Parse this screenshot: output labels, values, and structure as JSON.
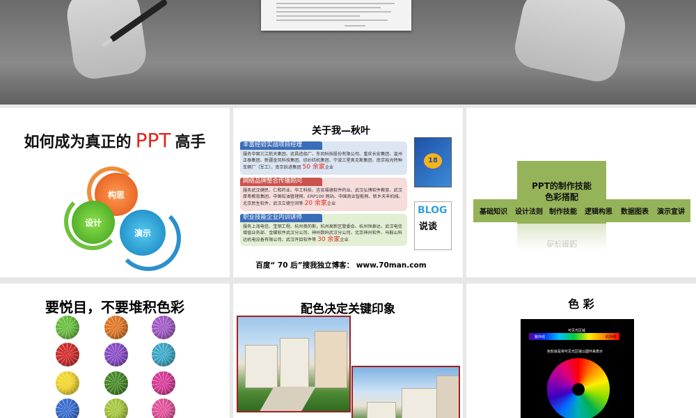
{
  "slides": [
    {
      "page": "",
      "title_pre": "如何成为真正的",
      "title_ppt": "PPT",
      "title_post": "高手",
      "gears": [
        "构思",
        "设计",
        "演示"
      ]
    },
    {
      "page": "",
      "title": "关于我—秋叶",
      "sections": [
        {
          "heading": "丰富经验实战项目经理",
          "body": "服务中国三江航天集团、武昌造船厂、东风科技股份有限公司、重庆长安集团、温州正泰集团、新疆金风科技集团、纺纱纺机集团、宁波三星奥克斯集团、南京裕光特种车辆厂（军工），南京跃进集团",
          "highlight": "50 余家",
          "suffix": "企业"
        },
        {
          "heading": "网络品牌整合传播顾问",
          "body": "服务武汉健民、仁和药业、华工科技、吉安福德软件药业、武汉弘博软件教育、武汉厚粤教育集团、中国石油管理网、ERP100 网站、中国商业智能网、新乡天丰机械、北京民生软件，武汉立德空间等",
          "highlight": "20 余家",
          "suffix": "企业"
        },
        {
          "heading": "职业技能企业内训讲师",
          "body": "服务上海电信、宝钢工程、杭州奥的斯，杭州高新区管委会、杭州恒泰达、武汉电信增值业务部、金蝶软件武汉分公司、神州数码武汉分公司、北京神州软件、马鞍山科达机电设备有限公司、武汉开目软件等",
          "highlight": "30 余家",
          "suffix": "企业"
        }
      ],
      "book1_text": "18",
      "book2_text": "说谈",
      "footer_pre": "百度“ 70 后”搜我独立博客： ",
      "footer_url": "www.70man.com"
    },
    {
      "title_line1": "PPT的制作技能",
      "title_line2": "色彩搭配",
      "bars": [
        "基础知识",
        "设计法则",
        "制作技能",
        "逻辑构思",
        "数据图表",
        "演示宣讲"
      ],
      "reflection": "色彩搭配"
    },
    {
      "title": "要悦目，不要堆积色彩"
    },
    {
      "title": "配色决定关键印象"
    },
    {
      "title": "色 彩",
      "spectrum_label": "可见光区域",
      "left_label": "紫外线",
      "right_label": "红外线",
      "caption": "色轮就是将可见光区域以圆环来表示"
    }
  ],
  "colors": {
    "accent_red": "#e0261d",
    "green_bar": "#95b358",
    "blue": "#3a6db8"
  },
  "ball_colors": [
    [
      "#6abf40",
      "#e07828",
      "#a25cc8"
    ],
    [
      "#d0302f",
      "#8a4fc8",
      "#3fa9c8"
    ],
    [
      "#f2d72e",
      "#4a8a2a",
      "#d83e9a"
    ],
    [
      "#3d6fd0",
      "#a7c73f",
      "#e2559a"
    ]
  ]
}
